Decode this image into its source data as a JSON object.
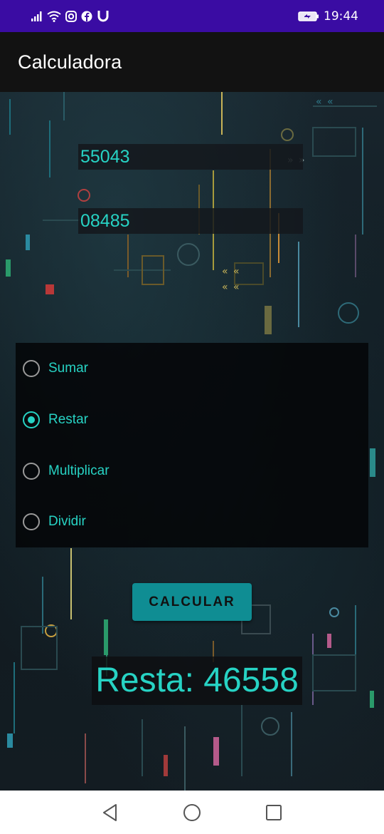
{
  "status_bar": {
    "time": "19:44",
    "left_icons": [
      "signal-icon",
      "wifi-icon",
      "instagram-icon",
      "facebook-icon",
      "magnet-icon"
    ],
    "right_icons": [
      "battery-icon"
    ]
  },
  "app_bar": {
    "title": "Calculadora"
  },
  "inputs": {
    "first_number": "55043",
    "second_number": "08485"
  },
  "operations": {
    "options": [
      {
        "label": "Sumar",
        "checked": false
      },
      {
        "label": "Restar",
        "checked": true
      },
      {
        "label": "Multiplicar",
        "checked": false
      },
      {
        "label": "Dividir",
        "checked": false
      }
    ]
  },
  "calculate_button": {
    "label": "CALCULAR"
  },
  "result": {
    "text": "Resta: 46558"
  },
  "colors": {
    "status_bar": "#3a0ca3",
    "app_bar": "#121212",
    "accent": "#27d3c4",
    "button": "#0f8d93"
  },
  "nav_bar": {
    "buttons": [
      "back-icon",
      "home-icon",
      "recents-icon"
    ]
  }
}
